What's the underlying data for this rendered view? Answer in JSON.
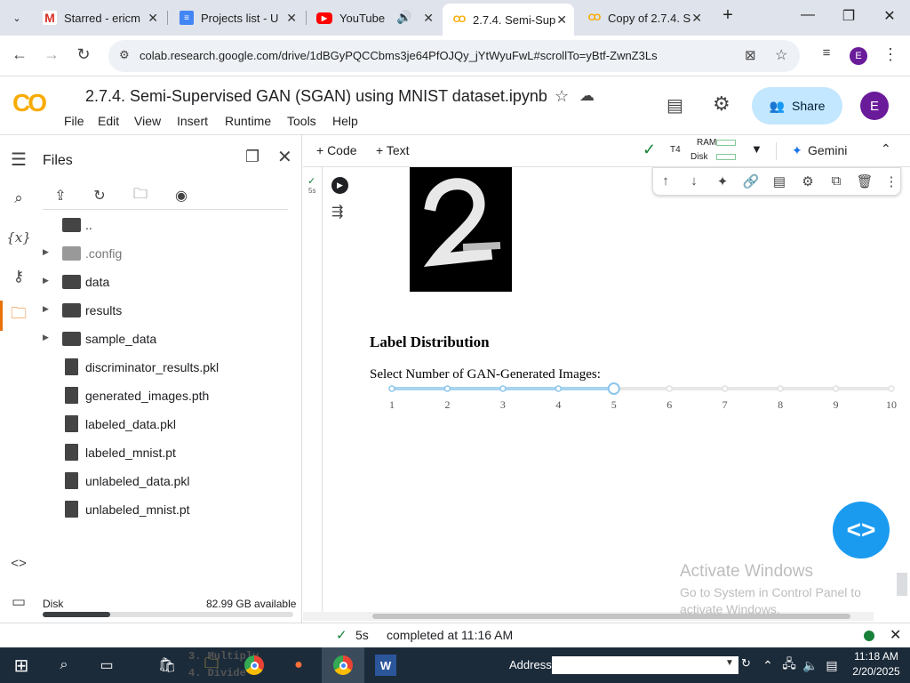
{
  "browser": {
    "tabs": [
      {
        "title": "Starred - ericm",
        "icon": "gmail-icon"
      },
      {
        "title": "Projects list - U",
        "icon": "docs-icon"
      },
      {
        "title": "YouTube",
        "icon": "youtube-icon"
      },
      {
        "title": "2.7.4. Semi-Sup",
        "icon": "colab-icon"
      },
      {
        "title": "Copy of 2.7.4. S",
        "icon": "colab-icon"
      }
    ],
    "url": "colab.research.google.com/drive/1dBGyPQCCbms3je64PfOJQy_jYtWyuFwL#scrollTo=yBtf-ZwnZ3Ls",
    "profile_initial": "E"
  },
  "colab": {
    "logo": "CO",
    "notebook_title": "2.7.4. Semi-Supervised GAN (SGAN) using MNIST dataset.ipynb",
    "menu": [
      "File",
      "Edit",
      "View",
      "Insert",
      "Runtime",
      "Tools",
      "Help"
    ],
    "share_label": "Share",
    "avatar_initial": "E"
  },
  "files_panel": {
    "title": "Files",
    "entries": [
      {
        "name": "..",
        "kind": "folder-up"
      },
      {
        "name": ".config",
        "kind": "folder",
        "dim": true
      },
      {
        "name": "data",
        "kind": "folder"
      },
      {
        "name": "results",
        "kind": "folder"
      },
      {
        "name": "sample_data",
        "kind": "folder"
      },
      {
        "name": "discriminator_results.pkl",
        "kind": "file"
      },
      {
        "name": "generated_images.pth",
        "kind": "file"
      },
      {
        "name": "labeled_data.pkl",
        "kind": "file"
      },
      {
        "name": "labeled_mnist.pt",
        "kind": "file"
      },
      {
        "name": "unlabeled_data.pkl",
        "kind": "file"
      },
      {
        "name": "unlabeled_mnist.pt",
        "kind": "file"
      }
    ],
    "disk_label": "Disk",
    "disk_available": "82.99 GB available",
    "disk_used_fraction": 0.27
  },
  "toolbar": {
    "code_label": "+ Code",
    "text_label": "+ Text",
    "runtime": "T4",
    "ram_label": "RAM",
    "disk_label": "Disk",
    "gemini_label": "Gemini"
  },
  "cell": {
    "exec_time": "5s",
    "heading": "Label Distribution",
    "slider_label": "Select Number of GAN-Generated Images:",
    "ticks": [
      "1",
      "2",
      "3",
      "4",
      "5",
      "6",
      "7",
      "8",
      "9",
      "10"
    ],
    "slider_value": 5
  },
  "watermark": {
    "line1": "Activate Windows",
    "line2": "Go to System in Control Panel to",
    "line3": "activate Windows."
  },
  "status": {
    "time": "5s",
    "completed": "completed at 11:16 AM"
  },
  "taskbar": {
    "address_label": "Address",
    "clock_time": "11:18 AM",
    "clock_date": "2/20/2025",
    "background_text": [
      "3. Multiply",
      "4. Divide"
    ]
  }
}
